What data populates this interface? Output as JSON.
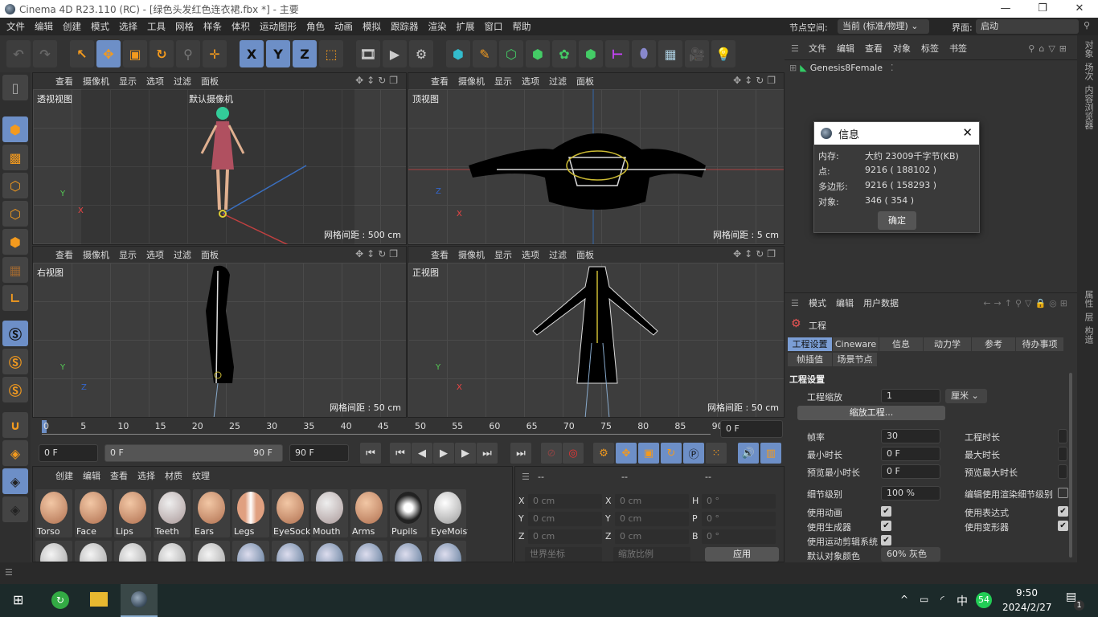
{
  "window": {
    "title": "Cinema 4D R23.110 (RC) - [绿色头发红色连衣裙.fbx *] - 主要",
    "minimize": "—",
    "maximize": "❐",
    "close": "✕"
  },
  "menu": [
    "文件",
    "编辑",
    "创建",
    "模式",
    "选择",
    "工具",
    "网格",
    "样条",
    "体积",
    "运动图形",
    "角色",
    "动画",
    "模拟",
    "跟踪器",
    "渲染",
    "扩展",
    "窗口",
    "帮助"
  ],
  "node_space": {
    "label": "节点空间:",
    "value": "当前 (标准/物理)"
  },
  "layout": {
    "label": "界面:",
    "value": "启动"
  },
  "toolbar": [
    "↶",
    "↷",
    "↖",
    "✥",
    "▣",
    "↻",
    "⚲",
    "✛",
    "X",
    "Y",
    "Z",
    "⬚",
    "🎞",
    "▶",
    "⚙",
    "⬢",
    "✎",
    "⬡",
    "⬢",
    "✿",
    "⬢",
    "⊢",
    "⬮",
    "▦",
    "🎥",
    "💡"
  ],
  "viewports": [
    {
      "menu": [
        "查看",
        "摄像机",
        "显示",
        "选项",
        "过滤",
        "面板"
      ],
      "name": "透视视图",
      "camera": "默认摄像机",
      "grid": "网格间距 : 500 cm"
    },
    {
      "menu": [
        "查看",
        "摄像机",
        "显示",
        "选项",
        "过滤",
        "面板"
      ],
      "name": "顶视图",
      "grid": "网格间距 : 5 cm"
    },
    {
      "menu": [
        "查看",
        "摄像机",
        "显示",
        "选项",
        "过滤",
        "面板"
      ],
      "name": "右视图",
      "grid": "网格间距 : 50 cm"
    },
    {
      "menu": [
        "查看",
        "摄像机",
        "显示",
        "选项",
        "过滤",
        "面板"
      ],
      "name": "正视图",
      "grid": "网格间距 : 50 cm"
    }
  ],
  "timeline": {
    "ticks": [
      "0",
      "5",
      "10",
      "15",
      "20",
      "25",
      "30",
      "35",
      "40",
      "45",
      "50",
      "55",
      "60",
      "65",
      "70",
      "75",
      "80",
      "85",
      "90"
    ],
    "current": "0 F",
    "start": "0 F",
    "range_start": "0 F",
    "range_end": "90 F",
    "end": "90 F"
  },
  "material_manager": {
    "menu": [
      "创建",
      "编辑",
      "查看",
      "选择",
      "材质",
      "纹理"
    ],
    "materials": [
      "Torso",
      "Face",
      "Lips",
      "Teeth",
      "Ears",
      "Legs",
      "EyeSocket",
      "Mouth",
      "Arms",
      "Pupils",
      "EyeMoisture"
    ]
  },
  "coordinates": {
    "headers": [
      "--",
      "--",
      "--"
    ],
    "rows": [
      [
        "X",
        "0 cm",
        "X",
        "0 cm",
        "H",
        "0 °"
      ],
      [
        "Y",
        "0 cm",
        "Y",
        "0 cm",
        "P",
        "0 °"
      ],
      [
        "Z",
        "0 cm",
        "Z",
        "0 cm",
        "B",
        "0 °"
      ]
    ],
    "mode": "世界坐标",
    "scale": "缩放比例",
    "apply": "应用"
  },
  "object_manager": {
    "menu": [
      "文件",
      "编辑",
      "查看",
      "对象",
      "标签",
      "书签"
    ],
    "objects": [
      "Genesis8Female"
    ]
  },
  "info_dialog": {
    "title": "信息",
    "rows": [
      [
        "内存:",
        "大约 23009千字节(KB)"
      ],
      [
        "点:",
        "9216 ( 188102 )"
      ],
      [
        "多边形:",
        "9216 ( 158293 )"
      ],
      [
        "对象:",
        "346 ( 354 )"
      ]
    ],
    "ok": "确定"
  },
  "attribute_manager": {
    "menu": [
      "模式",
      "编辑",
      "用户数据"
    ],
    "object": "工程",
    "tabs": [
      "工程设置",
      "Cineware",
      "信息",
      "动力学",
      "参考",
      "待办事项",
      "帧插值",
      "场景节点"
    ],
    "section": "工程设置",
    "scale_label": "工程缩放",
    "scale_value": "1",
    "scale_unit": "厘米",
    "scale_button": "缩放工程...",
    "fps_label": "帧率",
    "fps": "30",
    "min_label": "最小时长",
    "min": "0 F",
    "pmin_label": "预览最小时长",
    "pmin": "0 F",
    "dur_label": "工程时长",
    "max_label": "最大时长",
    "pmax_label": "预览最大时长",
    "lod_label": "细节级别",
    "lod": "100 %",
    "render_lod_label": "编辑使用渲染细节级别",
    "checks": [
      "使用动画",
      "使用生成器",
      "使用运动剪辑系统",
      "使用表达式",
      "使用变形器"
    ],
    "color_label": "默认对象颜色",
    "color_value": "60% 灰色"
  },
  "side_tabs": [
    "对象",
    "场次",
    "内容浏览器",
    "属性",
    "层",
    "构造"
  ],
  "taskbar": {
    "time": "9:50",
    "date": "2024/2/27",
    "ime": "中",
    "badge": "54",
    "notifications": "1"
  }
}
